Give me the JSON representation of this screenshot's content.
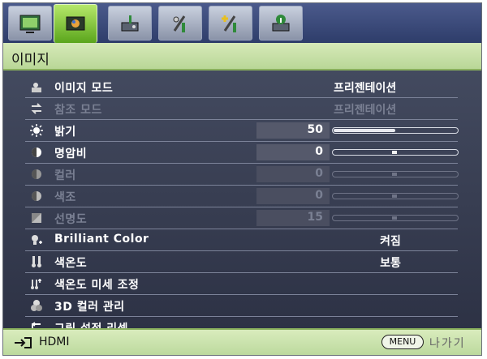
{
  "tabs": [
    {
      "icon": "display-icon",
      "active": false
    },
    {
      "icon": "picture-icon",
      "active": true
    },
    {
      "icon": "setup-icon",
      "active": false
    },
    {
      "icon": "system-icon",
      "active": false
    },
    {
      "icon": "advanced-icon",
      "active": false
    },
    {
      "icon": "information-icon",
      "active": false
    }
  ],
  "title": "이미지",
  "rows": [
    {
      "icon": "picture-mode-icon",
      "label": "이미지 모드",
      "value": "프리젠테이션",
      "disabled": false
    },
    {
      "icon": "reference-mode-icon",
      "label": "참조 모드",
      "value": "프리젠테이션",
      "disabled": true
    },
    {
      "icon": "brightness-icon",
      "label": "밝기",
      "number": "50",
      "level": 0.5,
      "disabled": false
    },
    {
      "icon": "contrast-icon",
      "label": "명암비",
      "number": "0",
      "level": 0.5,
      "disabled": false
    },
    {
      "icon": "color-icon",
      "label": "컬러",
      "number": "0",
      "level": 0.5,
      "disabled": true
    },
    {
      "icon": "tint-icon",
      "label": "색조",
      "number": "0",
      "level": 0.5,
      "disabled": true
    },
    {
      "icon": "sharpness-icon",
      "label": "선명도",
      "number": "15",
      "level": 0.5,
      "disabled": true
    },
    {
      "icon": "brilliant-color-icon",
      "label": "Brilliant Color",
      "value": "켜짐",
      "disabled": false
    },
    {
      "icon": "color-temperature-icon",
      "label": "색온도",
      "value": "보통",
      "disabled": false
    },
    {
      "icon": "color-temperature-fine-icon",
      "label": "색온도 미세 조정",
      "disabled": false
    },
    {
      "icon": "3d-color-icon",
      "label": "3D 컬러 관리",
      "disabled": false
    },
    {
      "icon": "reset-icon",
      "label": "그림 설정 리셋",
      "disabled": false
    }
  ],
  "footer": {
    "source": "HDMI",
    "menu_button": "MENU",
    "exit_label": "나가기"
  }
}
